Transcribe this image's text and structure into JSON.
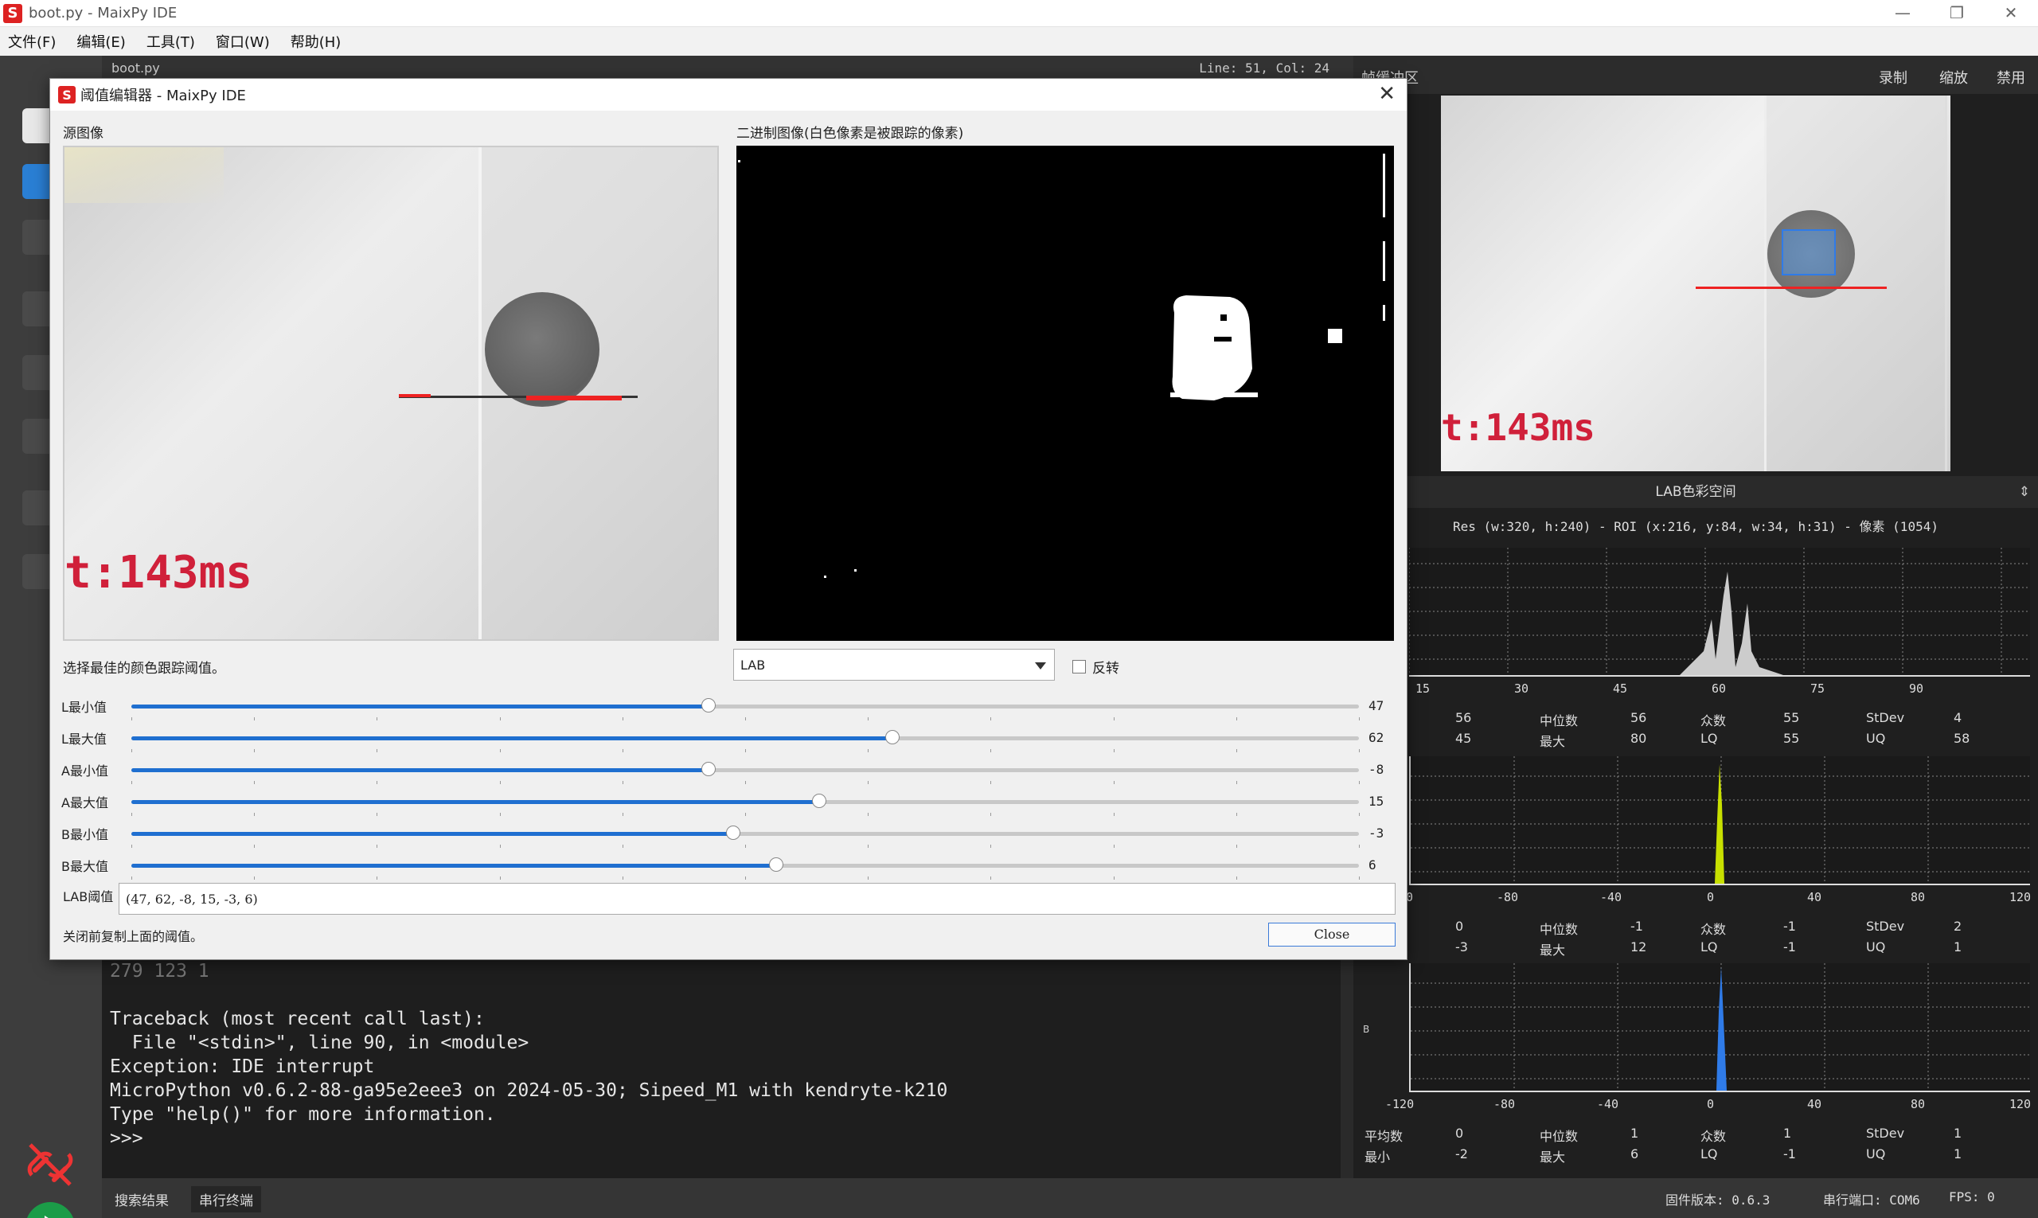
{
  "window": {
    "title": "boot.py - MaixPy IDE",
    "minimize": "—",
    "restore": "❐",
    "close": "✕"
  },
  "menu": [
    "文件(F)",
    "编辑(E)",
    "工具(T)",
    "窗口(W)",
    "帮助(H)"
  ],
  "editor": {
    "file_tab": "boot.py",
    "cursor": "Line: 51, Col: 24"
  },
  "terminal": {
    "lines": [
      "279 123 1",
      "",
      "Traceback (most recent call last):",
      "  File \"<stdin>\", line 90, in <module>",
      "Exception: IDE interrupt",
      "MicroPython v0.6.2-88-ga95e2eee3 on 2024-05-30; Sipeed_M1 with kendryte-k210",
      "Type \"help()\" for more information.",
      ">>>"
    ]
  },
  "statusbar": {
    "tab_search": "搜索结果",
    "tab_serial": "串行终端",
    "firmware": "固件版本: 0.6.3",
    "serial_port": "串行端口: COM6",
    "fps": "FPS: 0"
  },
  "framebuffer": {
    "label": "帧缓冲区",
    "btn_record": "录制",
    "btn_zoom": "缩放",
    "btn_disable": "禁用",
    "overlay": "t:143ms"
  },
  "histogram": {
    "colorspace": "LAB色彩空间",
    "spinner": "⇕",
    "res": "Res (w:320, h:240) - ROI (x:216, y:84, w:34, h:31) - 像素 (1054)",
    "l_axis": [
      "15",
      "30",
      "45",
      "60",
      "75",
      "90"
    ],
    "ab_axis": [
      "-120",
      "-80",
      "-40",
      "0",
      "40",
      "80",
      "120"
    ],
    "ab_axis_mid": [
      "0",
      "-80",
      "-40",
      "0",
      "40",
      "80",
      "120"
    ],
    "b_side_label": "B",
    "l_stats": {
      "mean": "56",
      "median_label": "中位数",
      "median": "56",
      "mode_label": "众数",
      "mode": "55",
      "stdev_label": "StDev",
      "stdev": "4",
      "min": "45",
      "max_label": "最大",
      "max": "80",
      "lq_label": "LQ",
      "lq": "55",
      "uq_label": "UQ",
      "uq": "58"
    },
    "a_stats": {
      "mean": "0",
      "median_label": "中位数",
      "median": "-1",
      "mode_label": "众数",
      "mode": "-1",
      "stdev_label": "StDev",
      "stdev": "2",
      "min": "-3",
      "max_label": "最大",
      "max": "12",
      "lq_label": "LQ",
      "lq": "-1",
      "uq_label": "UQ",
      "uq": "1"
    },
    "b_stats": {
      "mean_label": "平均数",
      "mean": "0",
      "median_label": "中位数",
      "median": "1",
      "mode_label": "众数",
      "mode": "1",
      "stdev_label": "StDev",
      "stdev": "1",
      "min_label": "最小",
      "min": "-2",
      "max_label": "最大",
      "max": "6",
      "lq_label": "LQ",
      "lq": "-1",
      "uq_label": "UQ",
      "uq": "1"
    }
  },
  "dialog": {
    "title": "阈值编辑器 - MaixPy IDE",
    "close_x": "✕",
    "source_label": "源图像",
    "binary_label": "二进制图像(白色像素是被跟踪的像素)",
    "source_overlay": "t:143ms",
    "choose_label": "选择最佳的颜色跟踪阈值。",
    "colorspace_value": "LAB",
    "invert_label": "反转",
    "sliders": [
      {
        "name": "L最小值",
        "value": "47",
        "fraction": 0.47
      },
      {
        "name": "L最大值",
        "value": "62",
        "fraction": 0.62
      },
      {
        "name": "A最小值",
        "value": "-8",
        "fraction": 0.47
      },
      {
        "name": "A最大值",
        "value": "15",
        "fraction": 0.56
      },
      {
        "name": "B最小值",
        "value": "-3",
        "fraction": 0.49
      },
      {
        "name": "B最大值",
        "value": "6",
        "fraction": 0.525
      }
    ],
    "lab_label": "LAB阈值",
    "lab_value": "(47, 62, -8, 15, -3, 6)",
    "copy_hint": "关闭前复制上面的阈值。",
    "close_button": "Close"
  },
  "colors": {
    "accent": "#1f6fd0",
    "run_green": "#1b9c48",
    "logo_red": "#dd2222",
    "hist_l": "#cccccc",
    "hist_a": "#c8e000",
    "hist_b": "#2f7be8"
  }
}
